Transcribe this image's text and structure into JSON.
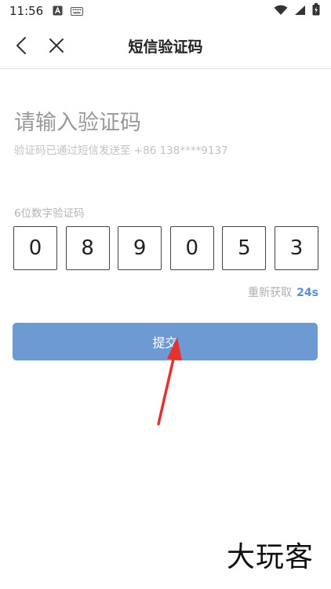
{
  "status_bar": {
    "time": "11:56",
    "left_icons": [
      "font-icon",
      "keyboard-icon"
    ],
    "right_icons": [
      "wifi-icon",
      "signal-icon",
      "battery-icon"
    ]
  },
  "nav": {
    "title": "短信验证码",
    "back_icon": "chevron-left-icon",
    "close_icon": "close-icon"
  },
  "main": {
    "heading": "请输入验证码",
    "subtext": "验证码已通过短信发送至 +86 138****9137",
    "code_label": "6位数字验证码",
    "code_digits": [
      "0",
      "8",
      "9",
      "0",
      "5",
      "3"
    ],
    "resend_label": "重新获取",
    "countdown": "24s",
    "submit_label": "提交"
  },
  "watermark": "大玩客",
  "colors": {
    "accent": "#6d9ad3",
    "countdown": "#5b8fcf",
    "arrow": "#e5322d"
  }
}
